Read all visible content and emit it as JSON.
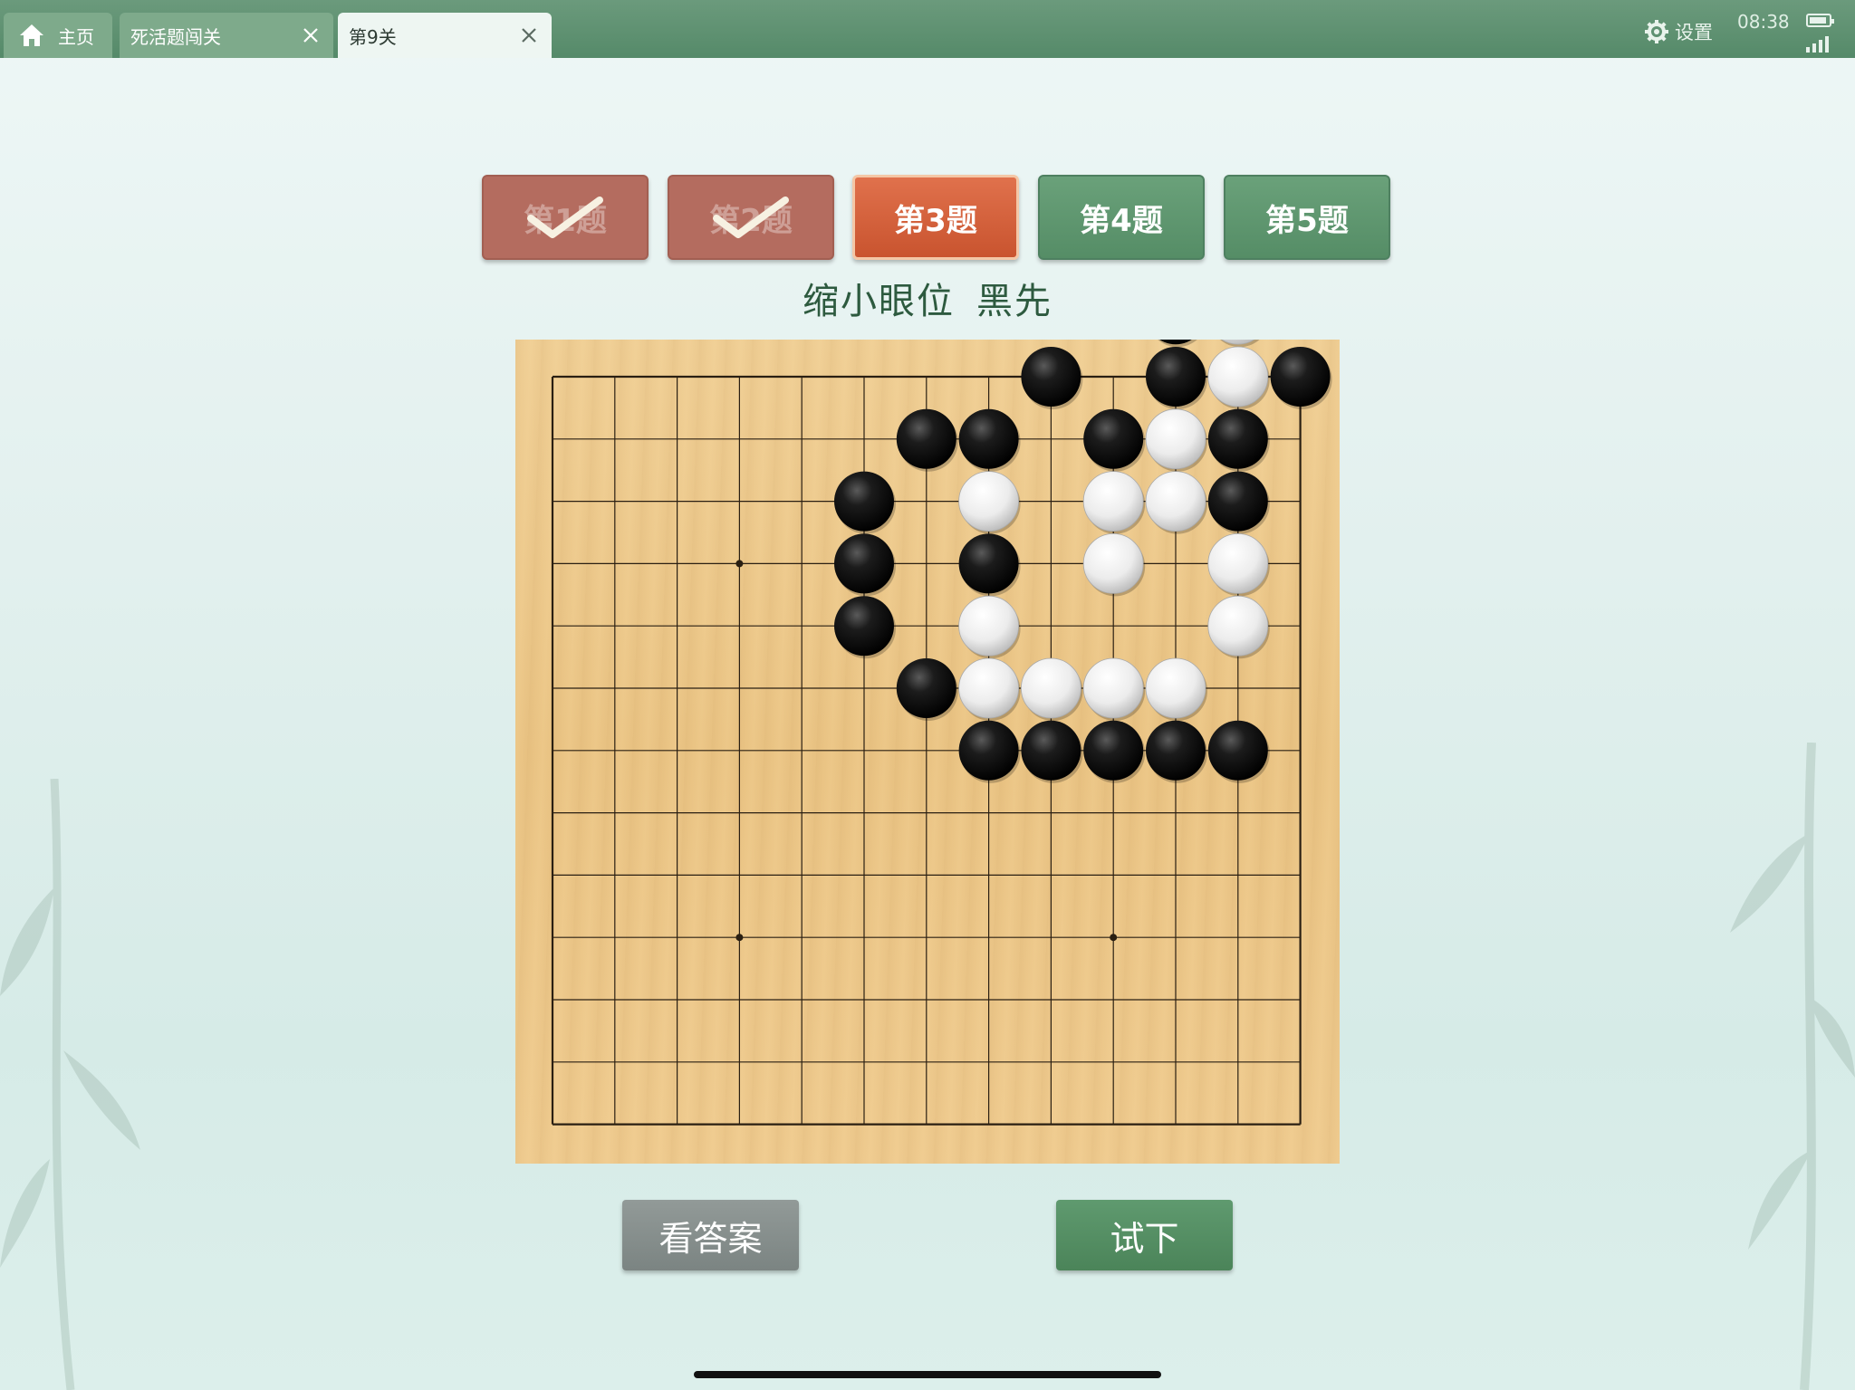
{
  "tabs": [
    {
      "label": "主页",
      "icon": "home-icon"
    },
    {
      "label": "死活题闯关",
      "icon": "close-icon"
    },
    {
      "label": "第9关",
      "icon": "close-icon",
      "active": true
    }
  ],
  "status": {
    "settings_label": "设置",
    "time": "08:38"
  },
  "problems": [
    {
      "label": "第1题",
      "state": "solved"
    },
    {
      "label": "第2题",
      "state": "solved"
    },
    {
      "label": "第3题",
      "state": "current"
    },
    {
      "label": "第4题",
      "state": "unsolved"
    },
    {
      "label": "第5题",
      "state": "unsolved"
    }
  ],
  "puzzle": {
    "title": "缩小眼位",
    "turn": "黑先"
  },
  "board": {
    "size": 13,
    "star_points": [
      [
        3,
        3
      ],
      [
        3,
        9
      ],
      [
        9,
        3
      ],
      [
        9,
        9
      ]
    ],
    "black": [
      [
        10,
        -1
      ],
      [
        8,
        0
      ],
      [
        10,
        0
      ],
      [
        12,
        0
      ],
      [
        6,
        1
      ],
      [
        7,
        1
      ],
      [
        9,
        1
      ],
      [
        11,
        1
      ],
      [
        5,
        2
      ],
      [
        11,
        2
      ],
      [
        5,
        3
      ],
      [
        7,
        3
      ],
      [
        5,
        4
      ],
      [
        6,
        5
      ],
      [
        7,
        6
      ],
      [
        8,
        6
      ],
      [
        9,
        6
      ],
      [
        10,
        6
      ],
      [
        11,
        6
      ]
    ],
    "white": [
      [
        11,
        -1
      ],
      [
        11,
        0
      ],
      [
        10,
        1
      ],
      [
        7,
        2
      ],
      [
        9,
        2
      ],
      [
        10,
        2
      ],
      [
        9,
        3
      ],
      [
        11,
        3
      ],
      [
        7,
        4
      ],
      [
        11,
        4
      ],
      [
        7,
        5
      ],
      [
        8,
        5
      ],
      [
        9,
        5
      ],
      [
        10,
        5
      ]
    ]
  },
  "buttons": {
    "answer": "看答案",
    "try": "试下"
  },
  "colors": {
    "header": "#558a69",
    "current_problem": "#d45f3a",
    "solved_problem": "#b46c5f",
    "unsolved_problem": "#5e9770",
    "title_text": "#2d5a3f",
    "board": "#ebc585"
  }
}
